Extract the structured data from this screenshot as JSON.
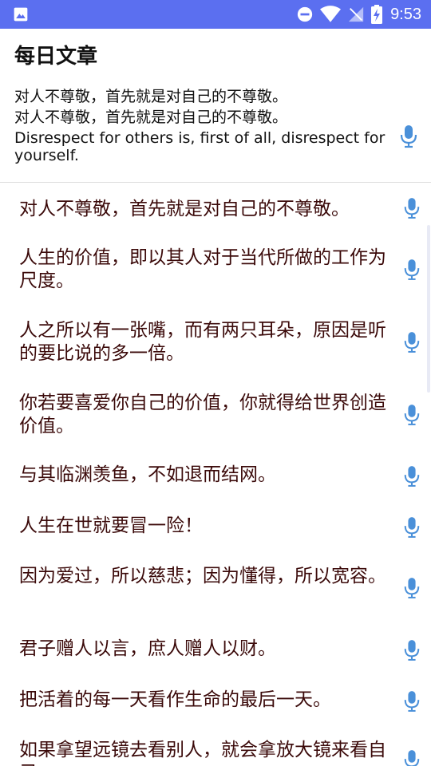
{
  "status_bar": {
    "time": "9:53",
    "icons": [
      "image-icon",
      "do-not-disturb-icon",
      "wifi-icon",
      "no-signal-icon",
      "battery-charging-icon"
    ],
    "background_color": "#5b6ff0"
  },
  "app": {
    "title": "每日文章"
  },
  "featured": {
    "line1": "对人不尊敬，首先就是对自己的不尊敬。",
    "line2": "对人不尊敬，首先就是对自己的不尊敬。",
    "english": "Disrespect for others is, first of all, disrespect for yourself."
  },
  "sentences": [
    "对人不尊敬，首先就是对自己的不尊敬。",
    "人生的价值，即以其人对于当代所做的工作为尺度。",
    "人之所以有一张嘴，而有两只耳朵，原因是听的要比说的多一倍。",
    "你若要喜爱你自己的价值，你就得给世界创造价值。",
    "与其临渊羡鱼，不如退而结网。",
    "人生在世就要冒一险！",
    "因为爱过，所以慈悲；因为懂得，所以宽容。",
    "君子赠人以言，庶人赠人以财。",
    "把活着的每一天看作生命的最后一天。",
    "如果拿望远镜去看别人，就会拿放大镜来看自己。"
  ],
  "colors": {
    "accent": "#5b6ff0",
    "mic": "#4a90d9",
    "sentence_text": "#3b0a0a"
  }
}
